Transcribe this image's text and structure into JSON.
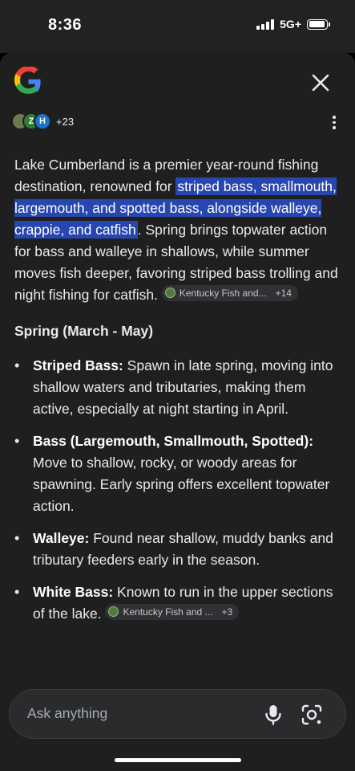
{
  "status": {
    "time": "8:36",
    "network": "5G+"
  },
  "header": {
    "more_sources_count": "+23",
    "source_badges": [
      "",
      "Z",
      "H"
    ]
  },
  "answer": {
    "intro_before": "Lake Cumberland is a premier year-round fishing destination, renowned for ",
    "intro_highlight": "striped bass, smallmouth, largemouth, and spotted bass, alongside walleye, crappie, and catfish",
    "intro_after": ". Spring brings topwater action for bass and walleye in shallows, while summer moves fish deeper, favoring striped bass trolling and night fishing for catfish.",
    "intro_citation": {
      "label": "Kentucky Fish and...",
      "count": "+14"
    },
    "section_title": "Spring (March - May)",
    "bullets": [
      {
        "term": "Striped Bass:",
        "text": " Spawn in late spring, moving into shallow waters and tributaries, making them active, especially at night starting in April."
      },
      {
        "term": "Bass (Largemouth, Smallmouth, Spotted):",
        "text": " Move to shallow, rocky, or woody areas for spawning. Early spring offers excellent topwater action."
      },
      {
        "term": "Walleye:",
        "text": " Found near shallow, muddy banks and tributary feeders early in the season."
      },
      {
        "term": "White Bass:",
        "text": " Known to run in the upper sections of the lake. "
      }
    ],
    "last_citation": {
      "label": "Kentucky Fish and ...",
      "count": "+3"
    }
  },
  "input": {
    "placeholder": "Ask anything"
  },
  "icons": {
    "logo": "google-g-icon",
    "close": "close-icon",
    "more": "more-vert-icon",
    "mic": "microphone-icon",
    "lens": "camera-search-icon"
  },
  "colors": {
    "highlight": "#2846b0",
    "sheet": "#1f1f1f"
  }
}
